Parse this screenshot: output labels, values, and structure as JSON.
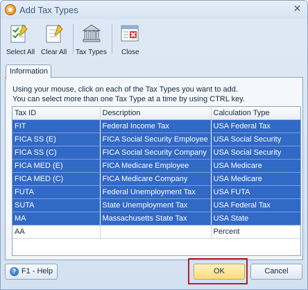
{
  "window": {
    "title": "Add Tax Types",
    "close_glyph": "✕"
  },
  "toolbar": {
    "items": [
      {
        "label": "Select All",
        "icon": "select-all-icon"
      },
      {
        "label": "Clear All",
        "icon": "clear-all-icon"
      },
      {
        "label": "Tax Types",
        "icon": "tax-types-icon"
      },
      {
        "label": "Close",
        "icon": "close-icon"
      }
    ]
  },
  "tab": {
    "label": "Information"
  },
  "instructions": {
    "line1": "Using your mouse, click on each of the Tax Types you want to add.",
    "line2": "You can select more than one Tax Type at a time by using CTRL key."
  },
  "grid": {
    "columns": [
      "Tax ID",
      "Description",
      "Calculation Type"
    ],
    "rows": [
      {
        "id": "FIT",
        "description": "Federal Income Tax",
        "calc": "USA Federal Tax",
        "selected": true
      },
      {
        "id": "FICA SS (E)",
        "description": "FICA Social Security Employee",
        "calc": "USA Social Security",
        "selected": true
      },
      {
        "id": "FICA SS (C)",
        "description": "FICA Social Security Company",
        "calc": "USA Social Security",
        "selected": true
      },
      {
        "id": "FICA MED (E)",
        "description": "FICA Medicare Employee",
        "calc": "USA Medicare",
        "selected": true
      },
      {
        "id": "FICA MED (C)",
        "description": "FICA Medicare Company",
        "calc": "USA Medicare",
        "selected": true
      },
      {
        "id": "FUTA",
        "description": "Federal Unemployment Tax",
        "calc": "USA FUTA",
        "selected": true
      },
      {
        "id": "SUTA",
        "description": "State Unemployment Tax",
        "calc": "USA Federal Tax",
        "selected": true
      },
      {
        "id": "MA",
        "description": "Massachusetts State Tax",
        "calc": "USA State",
        "selected": true
      },
      {
        "id": "AA",
        "description": "",
        "calc": "Percent",
        "selected": false
      }
    ]
  },
  "footer": {
    "help_label": "F1 - Help",
    "help_icon": "help-icon",
    "ok_label": "OK",
    "cancel_label": "Cancel"
  },
  "colors": {
    "selection": "#3169c6",
    "ok_highlight": "#fedb7a",
    "focus_frame": "#b22222"
  }
}
